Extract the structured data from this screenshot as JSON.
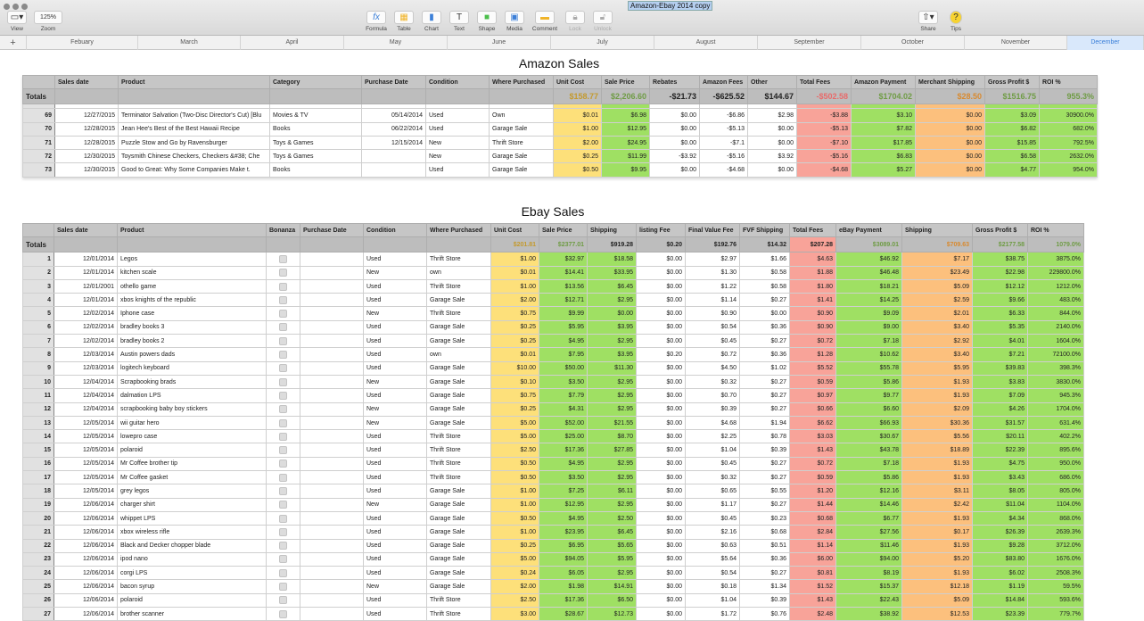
{
  "window": {
    "title": "Amazon-Ebay 2014 copy"
  },
  "toolbar": {
    "view": "View",
    "zoom_value": "125%",
    "zoom": "Zoom",
    "formula": "Formula",
    "table": "Table",
    "chart": "Chart",
    "text": "Text",
    "shape": "Shape",
    "media": "Media",
    "comment": "Comment",
    "lock": "Lock",
    "unlock": "Unlock",
    "share": "Share",
    "tips": "Tips"
  },
  "sheets": {
    "add": "+",
    "tabs": [
      "Febuary",
      "March",
      "April",
      "May",
      "June",
      "July",
      "August",
      "September",
      "October",
      "November",
      "December"
    ],
    "selected": "December"
  },
  "colors": {
    "unit_cost": "#fde07a",
    "positive": "#9fe063",
    "fees": "#f8a399",
    "shipping": "#fcc07d",
    "selected_tab": "#d9e8fb"
  },
  "amazon": {
    "title": "Amazon Sales",
    "headers": [
      "",
      "Sales date",
      "Product",
      "Category",
      "Purchase Date",
      "Condition",
      "Where Purchased",
      "Unit Cost",
      "Sale Price",
      "Rebates",
      "Amazon Fees",
      "Other",
      "Total Fees",
      "Amazon Payment",
      "Merchant Shipping",
      "Gross Profit $",
      "ROI %"
    ],
    "totals": [
      "Totals",
      "",
      "",
      "",
      "",
      "",
      "",
      "$158.77",
      "$2,206.60",
      "-$21.73",
      "-$625.52",
      "$144.67",
      "-$502.58",
      "$1704.02",
      "$28.50",
      "$1516.75",
      "955.3%"
    ],
    "rows": [
      [
        "69",
        "12/27/2015",
        "Terminator Salvation (Two-Disc Director's Cut) [Blu",
        "Movies & TV",
        "05/14/2014",
        "Used",
        "Own",
        "$0.01",
        "$6.98",
        "$0.00",
        "-$6.86",
        "$2.98",
        "-$3.88",
        "$3.10",
        "$0.00",
        "$3.09",
        "30900.0%"
      ],
      [
        "70",
        "12/28/2015",
        "Jean Hee's Best of the Best Hawaii Recipe",
        "Books",
        "06/22/2014",
        "Used",
        "Garage Sale",
        "$1.00",
        "$12.95",
        "$0.00",
        "-$5.13",
        "$0.00",
        "-$5.13",
        "$7.82",
        "$0.00",
        "$6.82",
        "682.0%"
      ],
      [
        "71",
        "12/28/2015",
        "Puzzle Stow and Go by Ravensburger",
        "Toys & Games",
        "12/15/2014",
        "New",
        "Thrift Store",
        "$2.00",
        "$24.95",
        "$0.00",
        "-$7.1",
        "$0.00",
        "-$7.10",
        "$17.85",
        "$0.00",
        "$15.85",
        "792.5%"
      ],
      [
        "72",
        "12/30/2015",
        "Toysmith Chinese Checkers, Checkers &#38; Che",
        "Toys & Games",
        "",
        "New",
        "Garage Sale",
        "$0.25",
        "$11.99",
        "-$3.92",
        "-$5.16",
        "$3.92",
        "-$5.16",
        "$6.83",
        "$0.00",
        "$6.58",
        "2632.0%"
      ],
      [
        "73",
        "12/30/2015",
        "Good to Great: Why Some Companies Make t.",
        "Books",
        "",
        "Used",
        "Garage Sale",
        "$0.50",
        "$9.95",
        "$0.00",
        "-$4.68",
        "$0.00",
        "-$4.68",
        "$5.27",
        "$0.00",
        "$4.77",
        "954.0%"
      ]
    ]
  },
  "ebay": {
    "title": "Ebay Sales",
    "headers": [
      "",
      "Sales date",
      "Product",
      "Bonanza",
      "Purchase Date",
      "Condition",
      "Where Purchased",
      "Unit Cost",
      "Sale Price",
      "Shipping",
      "listing Fee",
      "Final Value Fee",
      "FVF Shipping",
      "Total Fees",
      "eBay Payment",
      "Shipping",
      "Gross Profit $",
      "ROI %"
    ],
    "totals": [
      "Totals",
      "",
      "",
      "",
      "",
      "",
      "",
      "$201.81",
      "$2377.01",
      "$919.28",
      "$0.20",
      "$192.76",
      "$14.32",
      "$207.28",
      "$3089.01",
      "$709.63",
      "$2177.58",
      "1079.0%"
    ],
    "rows": [
      [
        "1",
        "12/01/2014",
        "Legos",
        false,
        "",
        "Used",
        "Thrift Store",
        "$1.00",
        "$32.97",
        "$18.58",
        "$0.00",
        "$2.97",
        "$1.66",
        "$4.63",
        "$46.92",
        "$7.17",
        "$38.75",
        "3875.0%"
      ],
      [
        "2",
        "12/01/2014",
        "kitchen scale",
        false,
        "",
        "New",
        "own",
        "$0.01",
        "$14.41",
        "$33.95",
        "$0.00",
        "$1.30",
        "$0.58",
        "$1.88",
        "$46.48",
        "$23.49",
        "$22.98",
        "229800.0%"
      ],
      [
        "3",
        "12/01/2001",
        "othello game",
        false,
        "",
        "Used",
        "Thrift Store",
        "$1.00",
        "$13.56",
        "$6.45",
        "$0.00",
        "$1.22",
        "$0.58",
        "$1.80",
        "$18.21",
        "$5.09",
        "$12.12",
        "1212.0%"
      ],
      [
        "4",
        "12/01/2014",
        "xbos knights of the republic",
        false,
        "",
        "Used",
        "Garage Sale",
        "$2.00",
        "$12.71",
        "$2.95",
        "$0.00",
        "$1.14",
        "$0.27",
        "$1.41",
        "$14.25",
        "$2.59",
        "$9.66",
        "483.0%"
      ],
      [
        "5",
        "12/02/2014",
        "Iphone case",
        false,
        "",
        "New",
        "Thrift Store",
        "$0.75",
        "$9.99",
        "$0.00",
        "$0.00",
        "$0.90",
        "$0.00",
        "$0.90",
        "$9.09",
        "$2.01",
        "$6.33",
        "844.0%"
      ],
      [
        "6",
        "12/02/2014",
        "bradley books 3",
        false,
        "",
        "Used",
        "Garage Sale",
        "$0.25",
        "$5.95",
        "$3.95",
        "$0.00",
        "$0.54",
        "$0.36",
        "$0.90",
        "$9.00",
        "$3.40",
        "$5.35",
        "2140.0%"
      ],
      [
        "7",
        "12/02/2014",
        "bradley books 2",
        false,
        "",
        "Used",
        "Garage Sale",
        "$0.25",
        "$4.95",
        "$2.95",
        "$0.00",
        "$0.45",
        "$0.27",
        "$0.72",
        "$7.18",
        "$2.92",
        "$4.01",
        "1604.0%"
      ],
      [
        "8",
        "12/03/2014",
        "Austin powers dads",
        false,
        "",
        "Used",
        "own",
        "$0.01",
        "$7.95",
        "$3.95",
        "$0.20",
        "$0.72",
        "$0.36",
        "$1.28",
        "$10.62",
        "$3.40",
        "$7.21",
        "72100.0%"
      ],
      [
        "9",
        "12/03/2014",
        "logitech keyboard",
        false,
        "",
        "Used",
        "Garage Sale",
        "$10.00",
        "$50.00",
        "$11.30",
        "$0.00",
        "$4.50",
        "$1.02",
        "$5.52",
        "$55.78",
        "$5.95",
        "$39.83",
        "398.3%"
      ],
      [
        "10",
        "12/04/2014",
        "Scrapbooking brads",
        false,
        "",
        "New",
        "Garage Sale",
        "$0.10",
        "$3.50",
        "$2.95",
        "$0.00",
        "$0.32",
        "$0.27",
        "$0.59",
        "$5.86",
        "$1.93",
        "$3.83",
        "3830.0%"
      ],
      [
        "11",
        "12/04/2014",
        "dalmation LPS",
        false,
        "",
        "Used",
        "Garage Sale",
        "$0.75",
        "$7.79",
        "$2.95",
        "$0.00",
        "$0.70",
        "$0.27",
        "$0.97",
        "$9.77",
        "$1.93",
        "$7.09",
        "945.3%"
      ],
      [
        "12",
        "12/04/2014",
        "scrapbooking baby boy stickers",
        false,
        "",
        "New",
        "Garage Sale",
        "$0.25",
        "$4.31",
        "$2.95",
        "$0.00",
        "$0.39",
        "$0.27",
        "$0.66",
        "$6.60",
        "$2.09",
        "$4.26",
        "1704.0%"
      ],
      [
        "13",
        "12/05/2014",
        "wii guitar hero",
        false,
        "",
        "New",
        "Garage Sale",
        "$5.00",
        "$52.00",
        "$21.55",
        "$0.00",
        "$4.68",
        "$1.94",
        "$6.62",
        "$66.93",
        "$30.36",
        "$31.57",
        "631.4%"
      ],
      [
        "14",
        "12/05/2014",
        "lowepro case",
        false,
        "",
        "Used",
        "Thrift Store",
        "$5.00",
        "$25.00",
        "$8.70",
        "$0.00",
        "$2.25",
        "$0.78",
        "$3.03",
        "$30.67",
        "$5.56",
        "$20.11",
        "402.2%"
      ],
      [
        "15",
        "12/05/2014",
        "polaroid",
        false,
        "",
        "Used",
        "Thrift Store",
        "$2.50",
        "$17.36",
        "$27.85",
        "$0.00",
        "$1.04",
        "$0.39",
        "$1.43",
        "$43.78",
        "$18.89",
        "$22.39",
        "895.6%"
      ],
      [
        "16",
        "12/05/2014",
        "Mr Coffee brother tip",
        false,
        "",
        "Used",
        "Thrift Store",
        "$0.50",
        "$4.95",
        "$2.95",
        "$0.00",
        "$0.45",
        "$0.27",
        "$0.72",
        "$7.18",
        "$1.93",
        "$4.75",
        "950.0%"
      ],
      [
        "17",
        "12/05/2014",
        "Mr Coffee gasket",
        false,
        "",
        "Used",
        "Thrift Store",
        "$0.50",
        "$3.50",
        "$2.95",
        "$0.00",
        "$0.32",
        "$0.27",
        "$0.59",
        "$5.86",
        "$1.93",
        "$3.43",
        "686.0%"
      ],
      [
        "18",
        "12/05/2014",
        "grey legos",
        false,
        "",
        "Used",
        "Garage Sale",
        "$1.00",
        "$7.25",
        "$6.11",
        "$0.00",
        "$0.65",
        "$0.55",
        "$1.20",
        "$12.16",
        "$3.11",
        "$8.05",
        "805.0%"
      ],
      [
        "19",
        "12/06/2014",
        "charger shirt",
        false,
        "",
        "New",
        "Garage Sale",
        "$1.00",
        "$12.95",
        "$2.95",
        "$0.00",
        "$1.17",
        "$0.27",
        "$1.44",
        "$14.46",
        "$2.42",
        "$11.04",
        "1104.0%"
      ],
      [
        "20",
        "12/06/2014",
        "whippet LPS",
        false,
        "",
        "Used",
        "Garage Sale",
        "$0.50",
        "$4.95",
        "$2.50",
        "$0.00",
        "$0.45",
        "$0.23",
        "$0.68",
        "$6.77",
        "$1.93",
        "$4.34",
        "868.0%"
      ],
      [
        "21",
        "12/06/2014",
        "xbox wireless rifle",
        false,
        "",
        "Used",
        "Garage Sale",
        "$1.00",
        "$23.95",
        "$6.45",
        "$0.00",
        "$2.16",
        "$0.68",
        "$2.84",
        "$27.56",
        "$0.17",
        "$26.39",
        "2639.3%"
      ],
      [
        "22",
        "12/06/2014",
        "Black and Decker chopper blade",
        false,
        "",
        "Used",
        "Garage Sale",
        "$0.25",
        "$6.95",
        "$5.65",
        "$0.00",
        "$0.63",
        "$0.51",
        "$1.14",
        "$11.46",
        "$1.93",
        "$9.28",
        "3712.0%"
      ],
      [
        "23",
        "12/06/2014",
        "ipod nano",
        false,
        "",
        "Used",
        "Garage Sale",
        "$5.00",
        "$94.05",
        "$5.95",
        "$0.00",
        "$5.64",
        "$0.36",
        "$6.00",
        "$94.00",
        "$5.20",
        "$83.80",
        "1676.0%"
      ],
      [
        "24",
        "12/06/2014",
        "corgi LPS",
        false,
        "",
        "Used",
        "Garage Sale",
        "$0.24",
        "$6.05",
        "$2.95",
        "$0.00",
        "$0.54",
        "$0.27",
        "$0.81",
        "$8.19",
        "$1.93",
        "$6.02",
        "2508.3%"
      ],
      [
        "25",
        "12/06/2014",
        "bacon syrup",
        false,
        "",
        "New",
        "Garage Sale",
        "$2.00",
        "$1.98",
        "$14.91",
        "$0.00",
        "$0.18",
        "$1.34",
        "$1.52",
        "$15.37",
        "$12.18",
        "$1.19",
        "59.5%"
      ],
      [
        "26",
        "12/06/2014",
        "polaroid",
        false,
        "",
        "Used",
        "Thrift Store",
        "$2.50",
        "$17.36",
        "$6.50",
        "$0.00",
        "$1.04",
        "$0.39",
        "$1.43",
        "$22.43",
        "$5.09",
        "$14.84",
        "593.6%"
      ],
      [
        "27",
        "12/06/2014",
        "brother scanner",
        false,
        "",
        "Used",
        "Thrift Store",
        "$3.00",
        "$28.67",
        "$12.73",
        "$0.00",
        "$1.72",
        "$0.76",
        "$2.48",
        "$38.92",
        "$12.53",
        "$23.39",
        "779.7%"
      ]
    ]
  }
}
